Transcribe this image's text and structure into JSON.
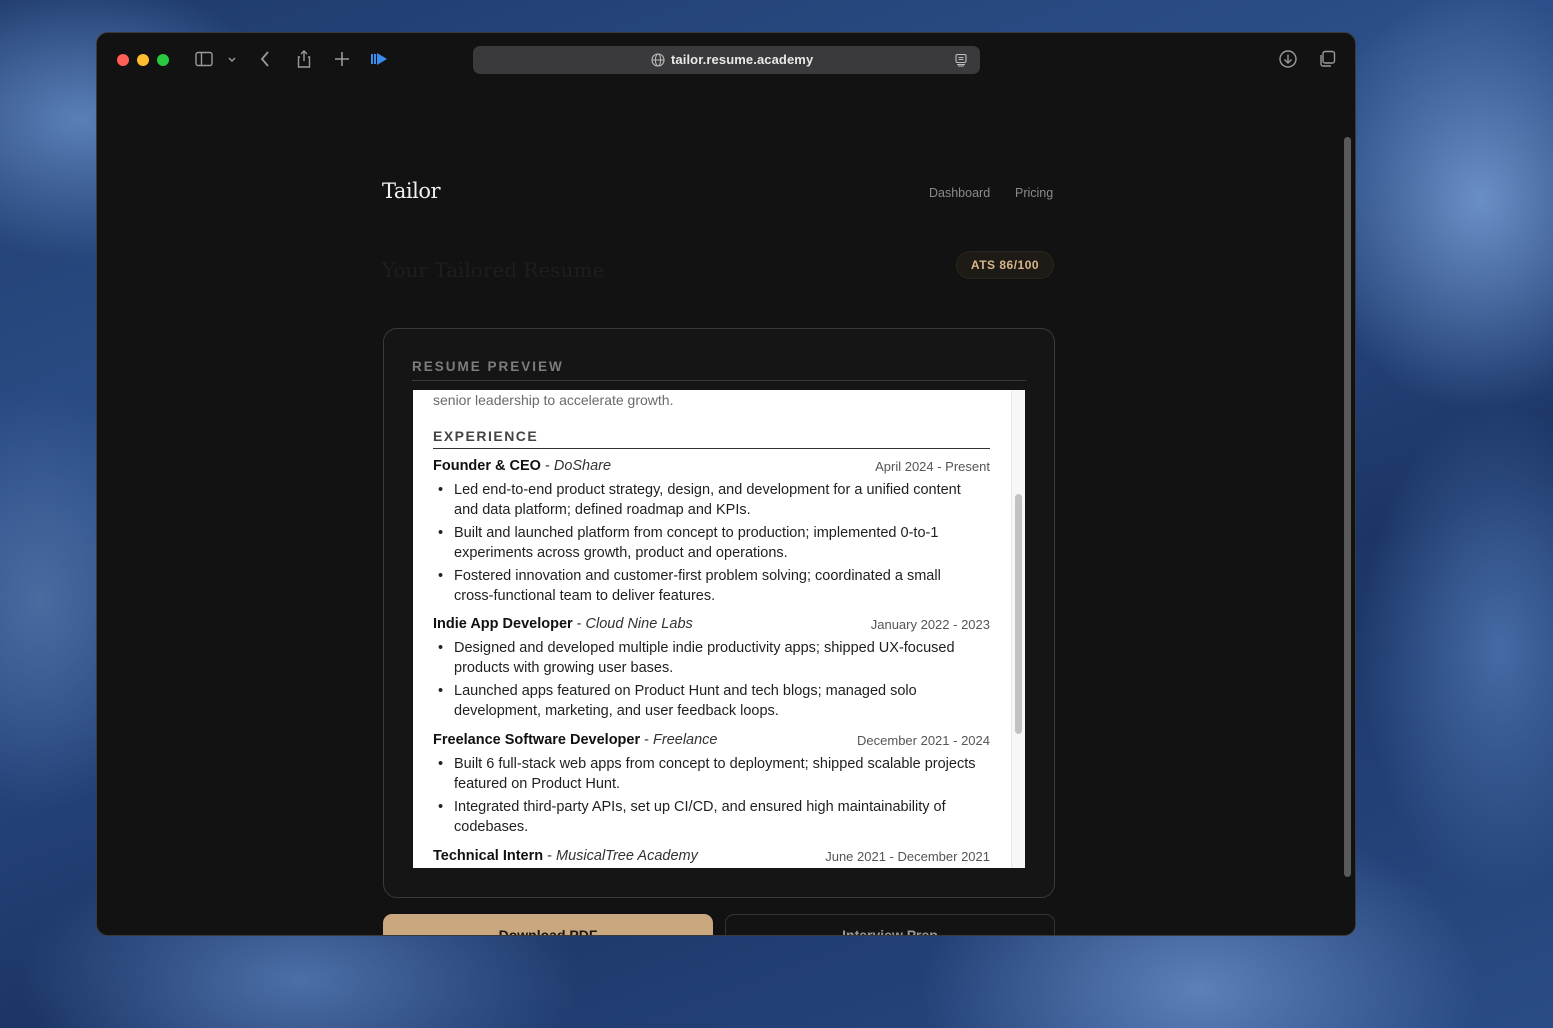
{
  "browser": {
    "url": "tailor.resume.academy",
    "icons": [
      "sidebar-icon",
      "chevron-down-icon",
      "back-icon",
      "share-icon",
      "new-tab-icon",
      "extension-icon",
      "globe-icon",
      "reader-icon",
      "downloads-icon",
      "tabs-overview-icon"
    ]
  },
  "header": {
    "logo": "Tailor",
    "nav": {
      "dashboard": "Dashboard",
      "pricing": "Pricing"
    }
  },
  "page": {
    "title": "Your Tailored Resume",
    "ats_badge": "ATS 86/100"
  },
  "preview": {
    "label": "RESUME PREVIEW",
    "summary_tail": "senior leadership to accelerate growth.",
    "section_heading": "EXPERIENCE",
    "jobs": [
      {
        "title": "Founder & CEO",
        "separator": " - ",
        "company": "DoShare",
        "dates": "April 2024 - Present",
        "bullets": [
          "Led end-to-end product strategy, design, and development for a unified content and data platform; defined roadmap and KPIs.",
          "Built and launched platform from concept to production; implemented 0-to-1 experiments across growth, product and operations.",
          "Fostered innovation and customer-first problem solving; coordinated a small cross-functional team to deliver features."
        ]
      },
      {
        "title": "Indie App Developer",
        "separator": " - ",
        "company": "Cloud Nine Labs",
        "dates": "January 2022 - 2023",
        "bullets": [
          "Designed and developed multiple indie productivity apps; shipped UX-focused products with growing user bases.",
          "Launched apps featured on Product Hunt and tech blogs; managed solo development, marketing, and user feedback loops."
        ]
      },
      {
        "title": "Freelance Software Developer",
        "separator": " - ",
        "company": "Freelance",
        "dates": "December 2021 - 2024",
        "bullets": [
          "Built 6 full-stack web apps from concept to deployment; shipped scalable projects featured on Product Hunt.",
          "Integrated third-party APIs, set up CI/CD, and ensured high maintainability of codebases."
        ]
      },
      {
        "title": "Technical Intern",
        "separator": " - ",
        "company": "MusicalTree Academy",
        "dates": "June 2021 - December 2021",
        "bullets": []
      }
    ]
  },
  "actions": {
    "download": "Download PDF",
    "interview": "Interview Prep"
  },
  "colors": {
    "accent": "#c9a87f",
    "badge_text": "#d7b789",
    "background": "#121212"
  }
}
